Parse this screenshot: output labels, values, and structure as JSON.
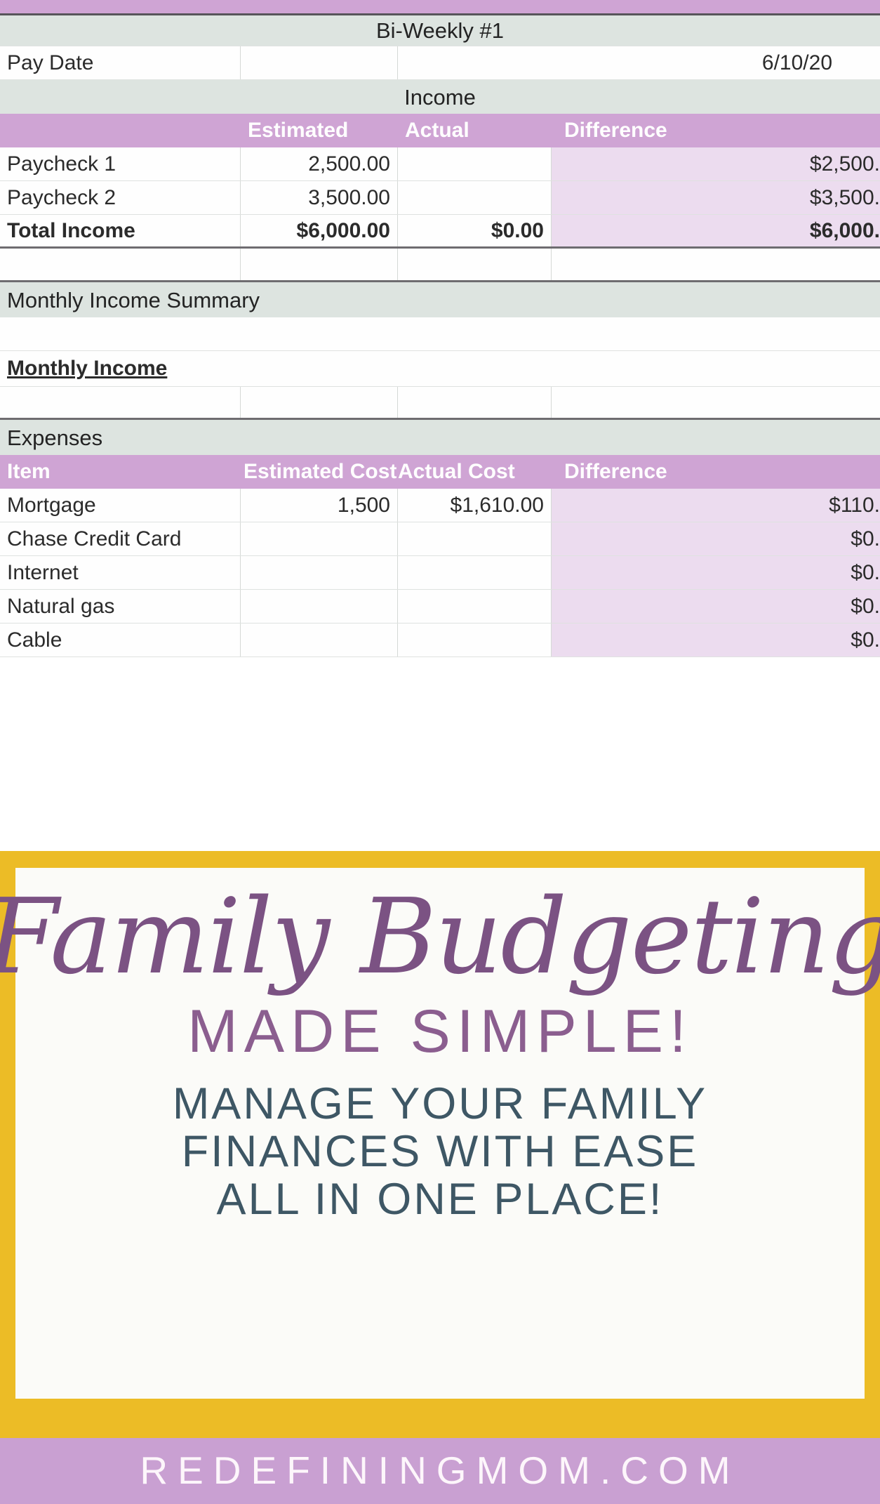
{
  "spreadsheet": {
    "title_row": {
      "label": "Bi-Weekly #1"
    },
    "pay_date": {
      "label": "Pay Date",
      "value": "6/10/20"
    },
    "income_section": {
      "band_label": "Income",
      "headers": {
        "item": "",
        "estimated": "Estimated",
        "actual": "Actual",
        "difference": "Difference"
      },
      "rows": [
        {
          "item": "Paycheck 1",
          "estimated": "2,500.00",
          "actual": "",
          "difference": "$2,500."
        },
        {
          "item": "Paycheck 2",
          "estimated": "3,500.00",
          "actual": "",
          "difference": "$3,500."
        },
        {
          "item": "Total Income",
          "estimated": "$6,000.00",
          "actual": "$0.00",
          "difference": "$6,000."
        }
      ]
    },
    "monthly_income_summary": {
      "band_label": "Monthly Income Summary"
    },
    "monthly_income": {
      "label": "Monthly Income"
    },
    "expenses_section": {
      "band_label": "Expenses",
      "headers": {
        "item": "Item",
        "estimated": "Estimated Cost",
        "actual": "Actual Cost",
        "difference": "Difference"
      },
      "rows": [
        {
          "item": "Mortgage",
          "estimated": "1,500",
          "actual": "$1,610.00",
          "difference": "$110."
        },
        {
          "item": "Chase Credit Card",
          "estimated": "",
          "actual": "",
          "difference": "$0."
        },
        {
          "item": "Internet",
          "estimated": "",
          "actual": "",
          "difference": "$0."
        },
        {
          "item": "Natural gas",
          "estimated": "",
          "actual": "",
          "difference": "$0."
        },
        {
          "item": "Cable",
          "estimated": "",
          "actual": "",
          "difference": "$0."
        }
      ]
    }
  },
  "promo": {
    "script_title": "Family Budgeting",
    "tagline": "MADE SIMPLE!",
    "subline_1": "MANAGE YOUR FAMILY",
    "subline_2": "FINANCES WITH EASE",
    "subline_3": "ALL IN ONE PLACE!"
  },
  "footer": {
    "website": "REDEFININGMOM.COM"
  },
  "colors": {
    "purple_header": "#cfa4d4",
    "purple_tint": "#ecdcef",
    "band_green": "#dde4e0",
    "gold_border": "#ecbc26",
    "script_purple": "#7b5283",
    "tagline_purple": "#8b5e8f",
    "subline_slate": "#3e5765",
    "footer_purple": "#c9a0d2"
  }
}
